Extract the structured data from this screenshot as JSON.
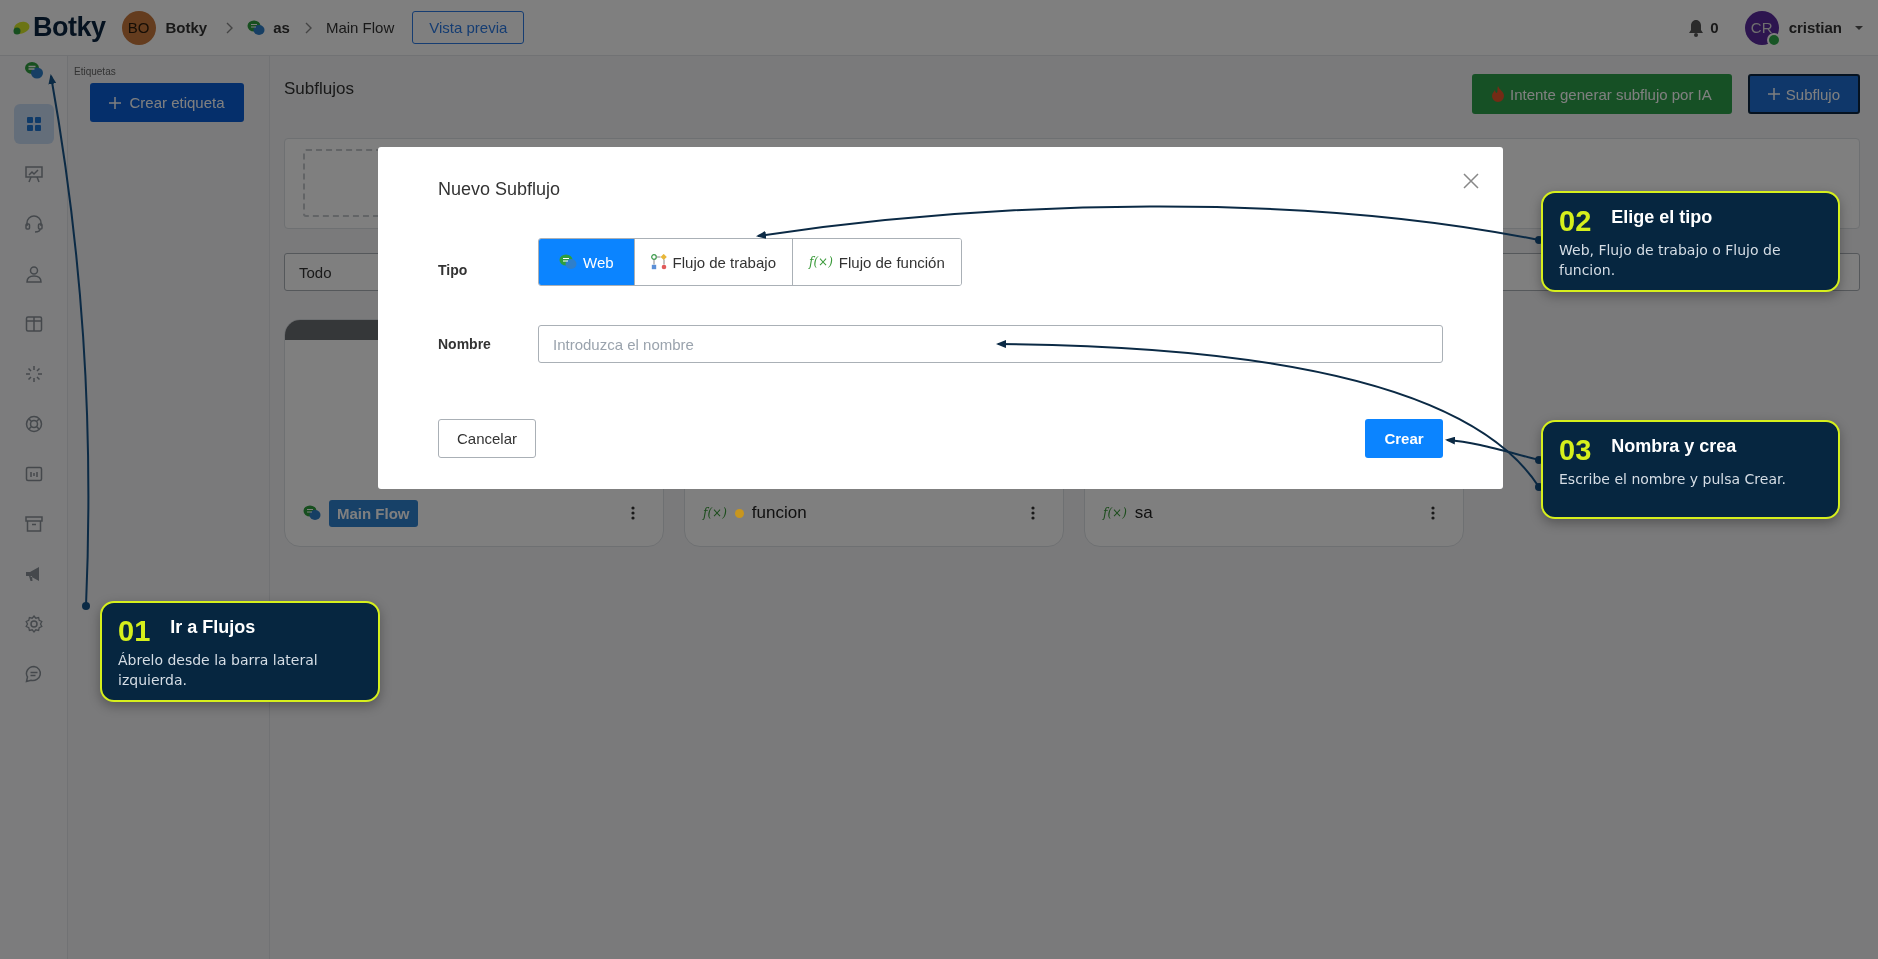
{
  "topbar": {
    "logo": "Botky",
    "workspace_avatar": "BO",
    "workspace": "Botky",
    "breadcrumbs": [
      {
        "label": "as",
        "kind": "web"
      },
      {
        "label": "Main Flow",
        "kind": "plain"
      }
    ],
    "preview_button": "Vista previa",
    "notifications": "0",
    "user_avatar": "CR",
    "user": "cristian",
    "user_online": true
  },
  "sidebar": {
    "items": [
      {
        "selected": false
      },
      {
        "selected": true
      },
      {
        "selected": false
      },
      {
        "selected": false
      },
      {
        "selected": false
      },
      {
        "selected": false
      },
      {
        "selected": false
      },
      {
        "selected": false
      },
      {
        "selected": false
      },
      {
        "selected": false
      },
      {
        "selected": false
      },
      {
        "selected": false
      },
      {
        "selected": false
      }
    ]
  },
  "tags_panel": {
    "title": "Etiquetas",
    "create_button": "Crear etiqueta"
  },
  "main": {
    "title": "Subflujos",
    "ai_button": "Intente generar subflujo por IA",
    "add_button": "Subflujo",
    "filter": {
      "value": "Todo"
    },
    "cards": [
      {
        "kind": "web",
        "label": "Main Flow"
      },
      {
        "kind": "function",
        "glyph": "f(×)",
        "label": "funcion",
        "color": "#c8961e"
      },
      {
        "kind": "function",
        "glyph": "f(×)",
        "label": "sa"
      }
    ]
  },
  "modal": {
    "title": "Nuevo Subflujo",
    "type_label": "Tipo",
    "types": [
      {
        "kind": "web",
        "label": "Web",
        "selected": true
      },
      {
        "kind": "workflow",
        "label": "Flujo de trabajo",
        "selected": false
      },
      {
        "kind": "function",
        "glyph": "f(×)",
        "label": "Flujo de función",
        "selected": false
      }
    ],
    "name_label": "Nombre",
    "name_field": {
      "placeholder": "Introduzca el nombre"
    },
    "cancel_button": "Cancelar",
    "create_button": "Crear"
  },
  "callouts": [
    {
      "number": "01",
      "title": "Ir a Flujos",
      "text": "Ábrelo desde la barra lateral izquierda."
    },
    {
      "number": "02",
      "title": "Elige el tipo",
      "text": "Web, Flujo de trabajo o Flujo de funcion."
    },
    {
      "number": "03",
      "title": "Nombra y crea",
      "text": "Escribe el nombre y pulsa Crear."
    }
  ]
}
